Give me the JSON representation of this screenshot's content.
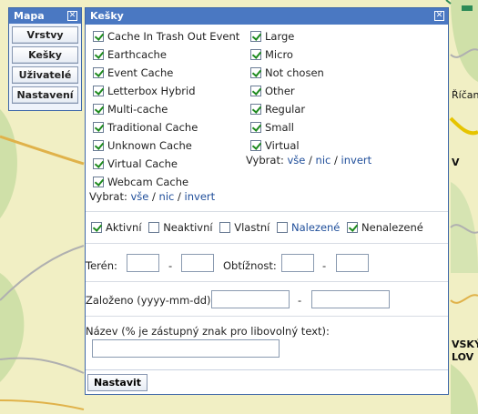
{
  "map": {
    "labels": {
      "ricany": "Říčany",
      "v": "V",
      "vsky": "VSKÝ",
      "lov": "LOV"
    }
  },
  "side_panel": {
    "title": "Mapa",
    "buttons": [
      "Vrstvy",
      "Kešky",
      "Uživatelé",
      "Nastavení"
    ]
  },
  "dialog": {
    "title": "Kešky",
    "types": [
      {
        "label": "Cache In Trash Out Event",
        "checked": true
      },
      {
        "label": "Earthcache",
        "checked": true
      },
      {
        "label": "Event Cache",
        "checked": true
      },
      {
        "label": "Letterbox Hybrid",
        "checked": true
      },
      {
        "label": "Multi-cache",
        "checked": true
      },
      {
        "label": "Traditional Cache",
        "checked": true
      },
      {
        "label": "Unknown Cache",
        "checked": true
      },
      {
        "label": "Virtual Cache",
        "checked": true
      },
      {
        "label": "Webcam Cache",
        "checked": true
      }
    ],
    "sizes": [
      {
        "label": "Large",
        "checked": true
      },
      {
        "label": "Micro",
        "checked": true
      },
      {
        "label": "Not chosen",
        "checked": true
      },
      {
        "label": "Other",
        "checked": true
      },
      {
        "label": "Regular",
        "checked": true
      },
      {
        "label": "Small",
        "checked": true
      },
      {
        "label": "Virtual",
        "checked": true
      }
    ],
    "select": {
      "label": "Vybrat:",
      "all": "vše",
      "none": "nic",
      "invert": "invert",
      "slash": "/"
    },
    "status": [
      {
        "label": "Aktivní",
        "checked": true
      },
      {
        "label": "Neaktivní",
        "checked": false
      },
      {
        "label": "Vlastní",
        "checked": false
      },
      {
        "label": "Nalezené",
        "checked": false
      },
      {
        "label": "Nenalezené",
        "checked": true
      }
    ],
    "terrain_label": "Terén:",
    "difficulty_label": "Obtížnost:",
    "dash": "-",
    "founded_label": "Založeno (yyyy-mm-dd):",
    "name_label": "Název (% je zástupný znak pro libovolný text):",
    "submit_label": "Nastavit"
  }
}
